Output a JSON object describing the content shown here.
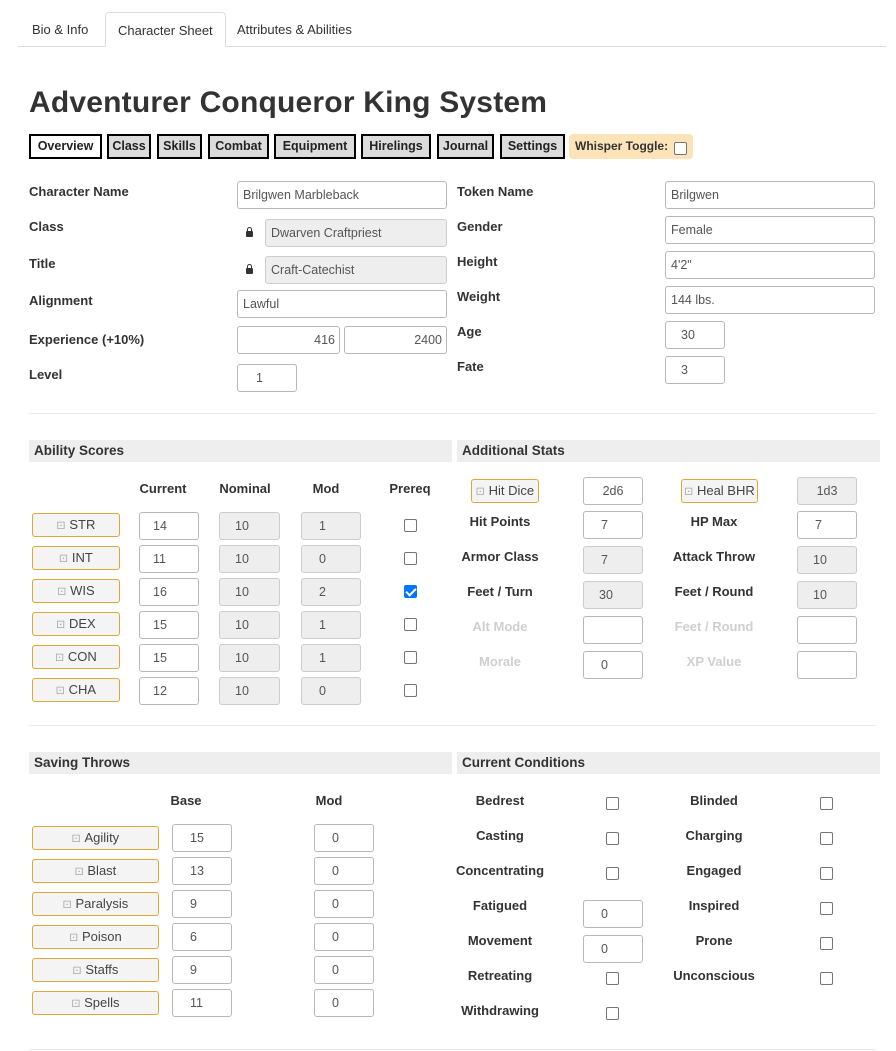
{
  "tabs": [
    "Bio & Info",
    "Character Sheet",
    "Attributes & Abilities"
  ],
  "title": "Adventurer Conqueror King System",
  "sheet_buttons": [
    "Overview",
    "Class",
    "Skills",
    "Combat",
    "Equipment",
    "Hirelings",
    "Journal",
    "Settings"
  ],
  "whisper_label": "Whisper Toggle:",
  "char": {
    "name_label": "Character Name",
    "name": "Brilgwen Marbleback",
    "class_label": "Class",
    "class": "Dwarven Craftpriest",
    "title_label": "Title",
    "title": "Craft-Catechist",
    "alignment_label": "Alignment",
    "alignment": "Lawful",
    "xp_label": "Experience (+10%)",
    "xp": "416",
    "xp_next": "2400",
    "level_label": "Level",
    "level": "1",
    "token_label": "Token Name",
    "token": "Brilgwen",
    "gender_label": "Gender",
    "gender": "Female",
    "height_label": "Height",
    "height": "4'2\"",
    "weight_label": "Weight",
    "weight": "144 lbs.",
    "age_label": "Age",
    "age": "30",
    "fate_label": "Fate",
    "fate": "3"
  },
  "ability": {
    "header": "Ability Scores",
    "cols": [
      "Current",
      "Nominal",
      "Mod",
      "Prereq"
    ],
    "rows": [
      {
        "name": "STR",
        "current": "14",
        "nominal": "10",
        "mod": "1"
      },
      {
        "name": "INT",
        "current": "11",
        "nominal": "10",
        "mod": "0"
      },
      {
        "name": "WIS",
        "current": "16",
        "nominal": "10",
        "mod": "2"
      },
      {
        "name": "DEX",
        "current": "15",
        "nominal": "10",
        "mod": "1"
      },
      {
        "name": "CON",
        "current": "15",
        "nominal": "10",
        "mod": "1"
      },
      {
        "name": "CHA",
        "current": "12",
        "nominal": "10",
        "mod": "0"
      }
    ],
    "prereq_checked": [
      false,
      false,
      true,
      false,
      false,
      false
    ]
  },
  "additional": {
    "header": "Additional Stats",
    "hit_dice_label": "Hit Dice",
    "hit_dice": "2d6",
    "heal_label": "Heal BHR",
    "heal": "1d3",
    "hp_label": "Hit Points",
    "hp": "7",
    "hpmax_label": "HP Max",
    "hpmax": "7",
    "ac_label": "Armor Class",
    "ac": "7",
    "attack_label": "Attack Throw",
    "attack": "10",
    "ft_turn_label": "Feet / Turn",
    "ft_turn": "30",
    "ft_round_label": "Feet / Round",
    "ft_round": "10",
    "alt_mode_label": "Alt Mode",
    "alt_mode": "",
    "ft_round2_label": "Feet / Round",
    "ft_round2": "",
    "morale_label": "Morale",
    "morale": "0",
    "xp_value_label": "XP Value",
    "xp_value": ""
  },
  "saves": {
    "header": "Saving Throws",
    "cols": [
      "Base",
      "Mod"
    ],
    "rows": [
      {
        "name": "Agility",
        "base": "15",
        "mod": "0"
      },
      {
        "name": "Blast",
        "base": "13",
        "mod": "0"
      },
      {
        "name": "Paralysis",
        "base": "9",
        "mod": "0"
      },
      {
        "name": "Poison",
        "base": "6",
        "mod": "0"
      },
      {
        "name": "Staffs",
        "base": "9",
        "mod": "0"
      },
      {
        "name": "Spells",
        "base": "11",
        "mod": "0"
      }
    ]
  },
  "conditions": {
    "header": "Current Conditions",
    "left": [
      "Bedrest",
      "Casting",
      "Concentrating",
      "Fatigued",
      "Movement",
      "Retreating",
      "Withdrawing"
    ],
    "right": [
      "Blinded",
      "Charging",
      "Engaged",
      "Inspired",
      "Prone",
      "Unconscious"
    ],
    "fatigued": "0",
    "movement": "0"
  },
  "colors": {
    "roll_border": "#e0a83a",
    "whisper_bg": "#fde3b8",
    "checked": "#0075ff",
    "section_bg": "#eeeeee"
  }
}
